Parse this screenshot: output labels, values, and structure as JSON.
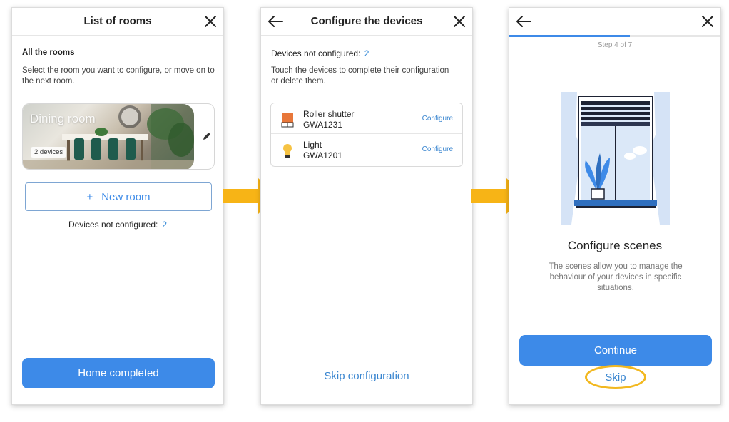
{
  "screen1": {
    "title": "List of rooms",
    "all_rooms_heading": "All the rooms",
    "description": "Select the room you want to configure, or move on to the next room.",
    "room": {
      "name": "Dining room",
      "devices": "2 devices"
    },
    "new_room_icon": "+",
    "new_room_label": "New room",
    "devices_not_configured_label": "Devices not configured:",
    "devices_not_configured_count": "2",
    "home_completed_label": "Home completed"
  },
  "screen2": {
    "title": "Configure the devices",
    "devices_not_configured_label": "Devices not configured:",
    "devices_not_configured_count": "2",
    "description": "Touch the devices to complete their configuration or delete them.",
    "devices": [
      {
        "name": "Roller shutter",
        "code": "GWA1231",
        "action": "Configure",
        "icon": "roller-shutter-icon"
      },
      {
        "name": "Light",
        "code": "GWA1201",
        "action": "Configure",
        "icon": "light-bulb-icon"
      }
    ],
    "skip_label": "Skip configuration"
  },
  "screen3": {
    "step": "Step 4 of 7",
    "progress": 0.57,
    "title": "Configure scenes",
    "description": "The scenes allow you to manage the behaviour of your devices in specific situations.",
    "continue_label": "Continue",
    "skip_label": "Skip"
  },
  "colors": {
    "primary": "#3d8ae8",
    "link": "#3a86d0",
    "arrow": "#f7b416",
    "highlight": "#f2b820"
  }
}
